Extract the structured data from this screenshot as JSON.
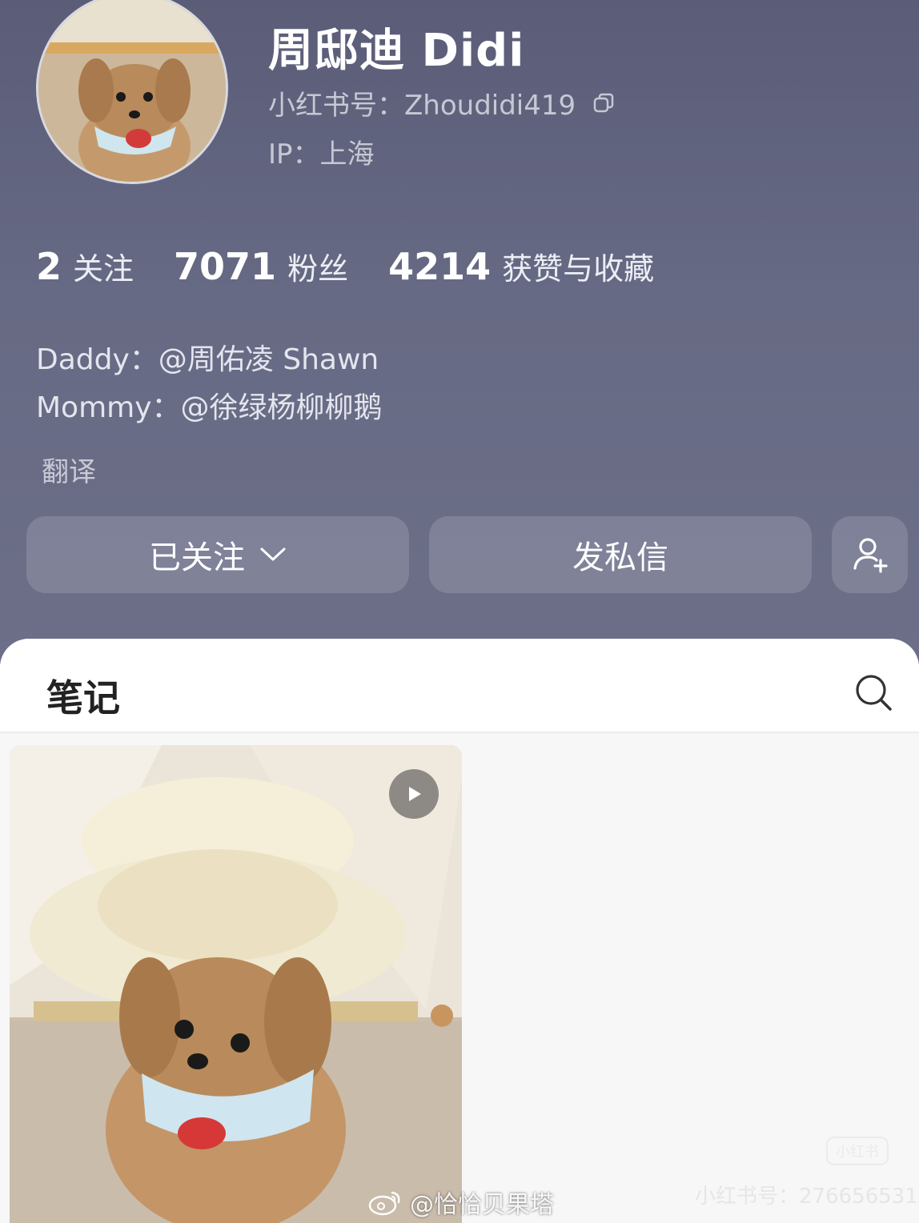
{
  "profile": {
    "name": "周邸迪 Didi",
    "id_line": "小红书号：Zhoudidi419",
    "ip_line": "IP：上海"
  },
  "stats": [
    {
      "value": "2",
      "label": "关注"
    },
    {
      "value": "7071",
      "label": "粉丝"
    },
    {
      "value": "4214",
      "label": "获赞与收藏"
    }
  ],
  "bio": {
    "line1": "Daddy：@周佑凌 Shawn",
    "line2": "Mommy：@徐绿杨柳柳鹅"
  },
  "translate_label": "翻译",
  "actions": {
    "follow_label": "已关注",
    "message_label": "发私信"
  },
  "tabs": {
    "notes_label": "笔记"
  },
  "watermarks": {
    "weibo": "@恰恰贝果塔",
    "xhs_id": "小红书号：276656531",
    "xhs_logo": "小红书"
  },
  "colors": {
    "header_bg": "#62647e",
    "panel_bg": "#f7f7f7"
  }
}
